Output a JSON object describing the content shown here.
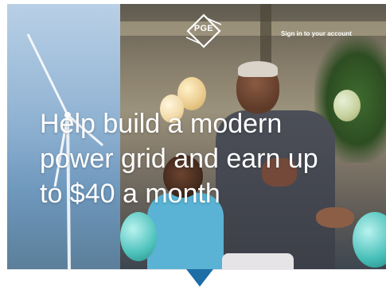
{
  "header": {
    "logo_text": "PGE",
    "signin_label": "Sign in to your account"
  },
  "hero": {
    "headline": "Help build a modern power grid and earn up to $40 a month"
  },
  "colors": {
    "accent": "#1d6ea7",
    "headline_text": "#ffffff"
  },
  "icons": {
    "logo": "pge-diamond-logo-icon",
    "scroll": "chevron-down-icon"
  }
}
